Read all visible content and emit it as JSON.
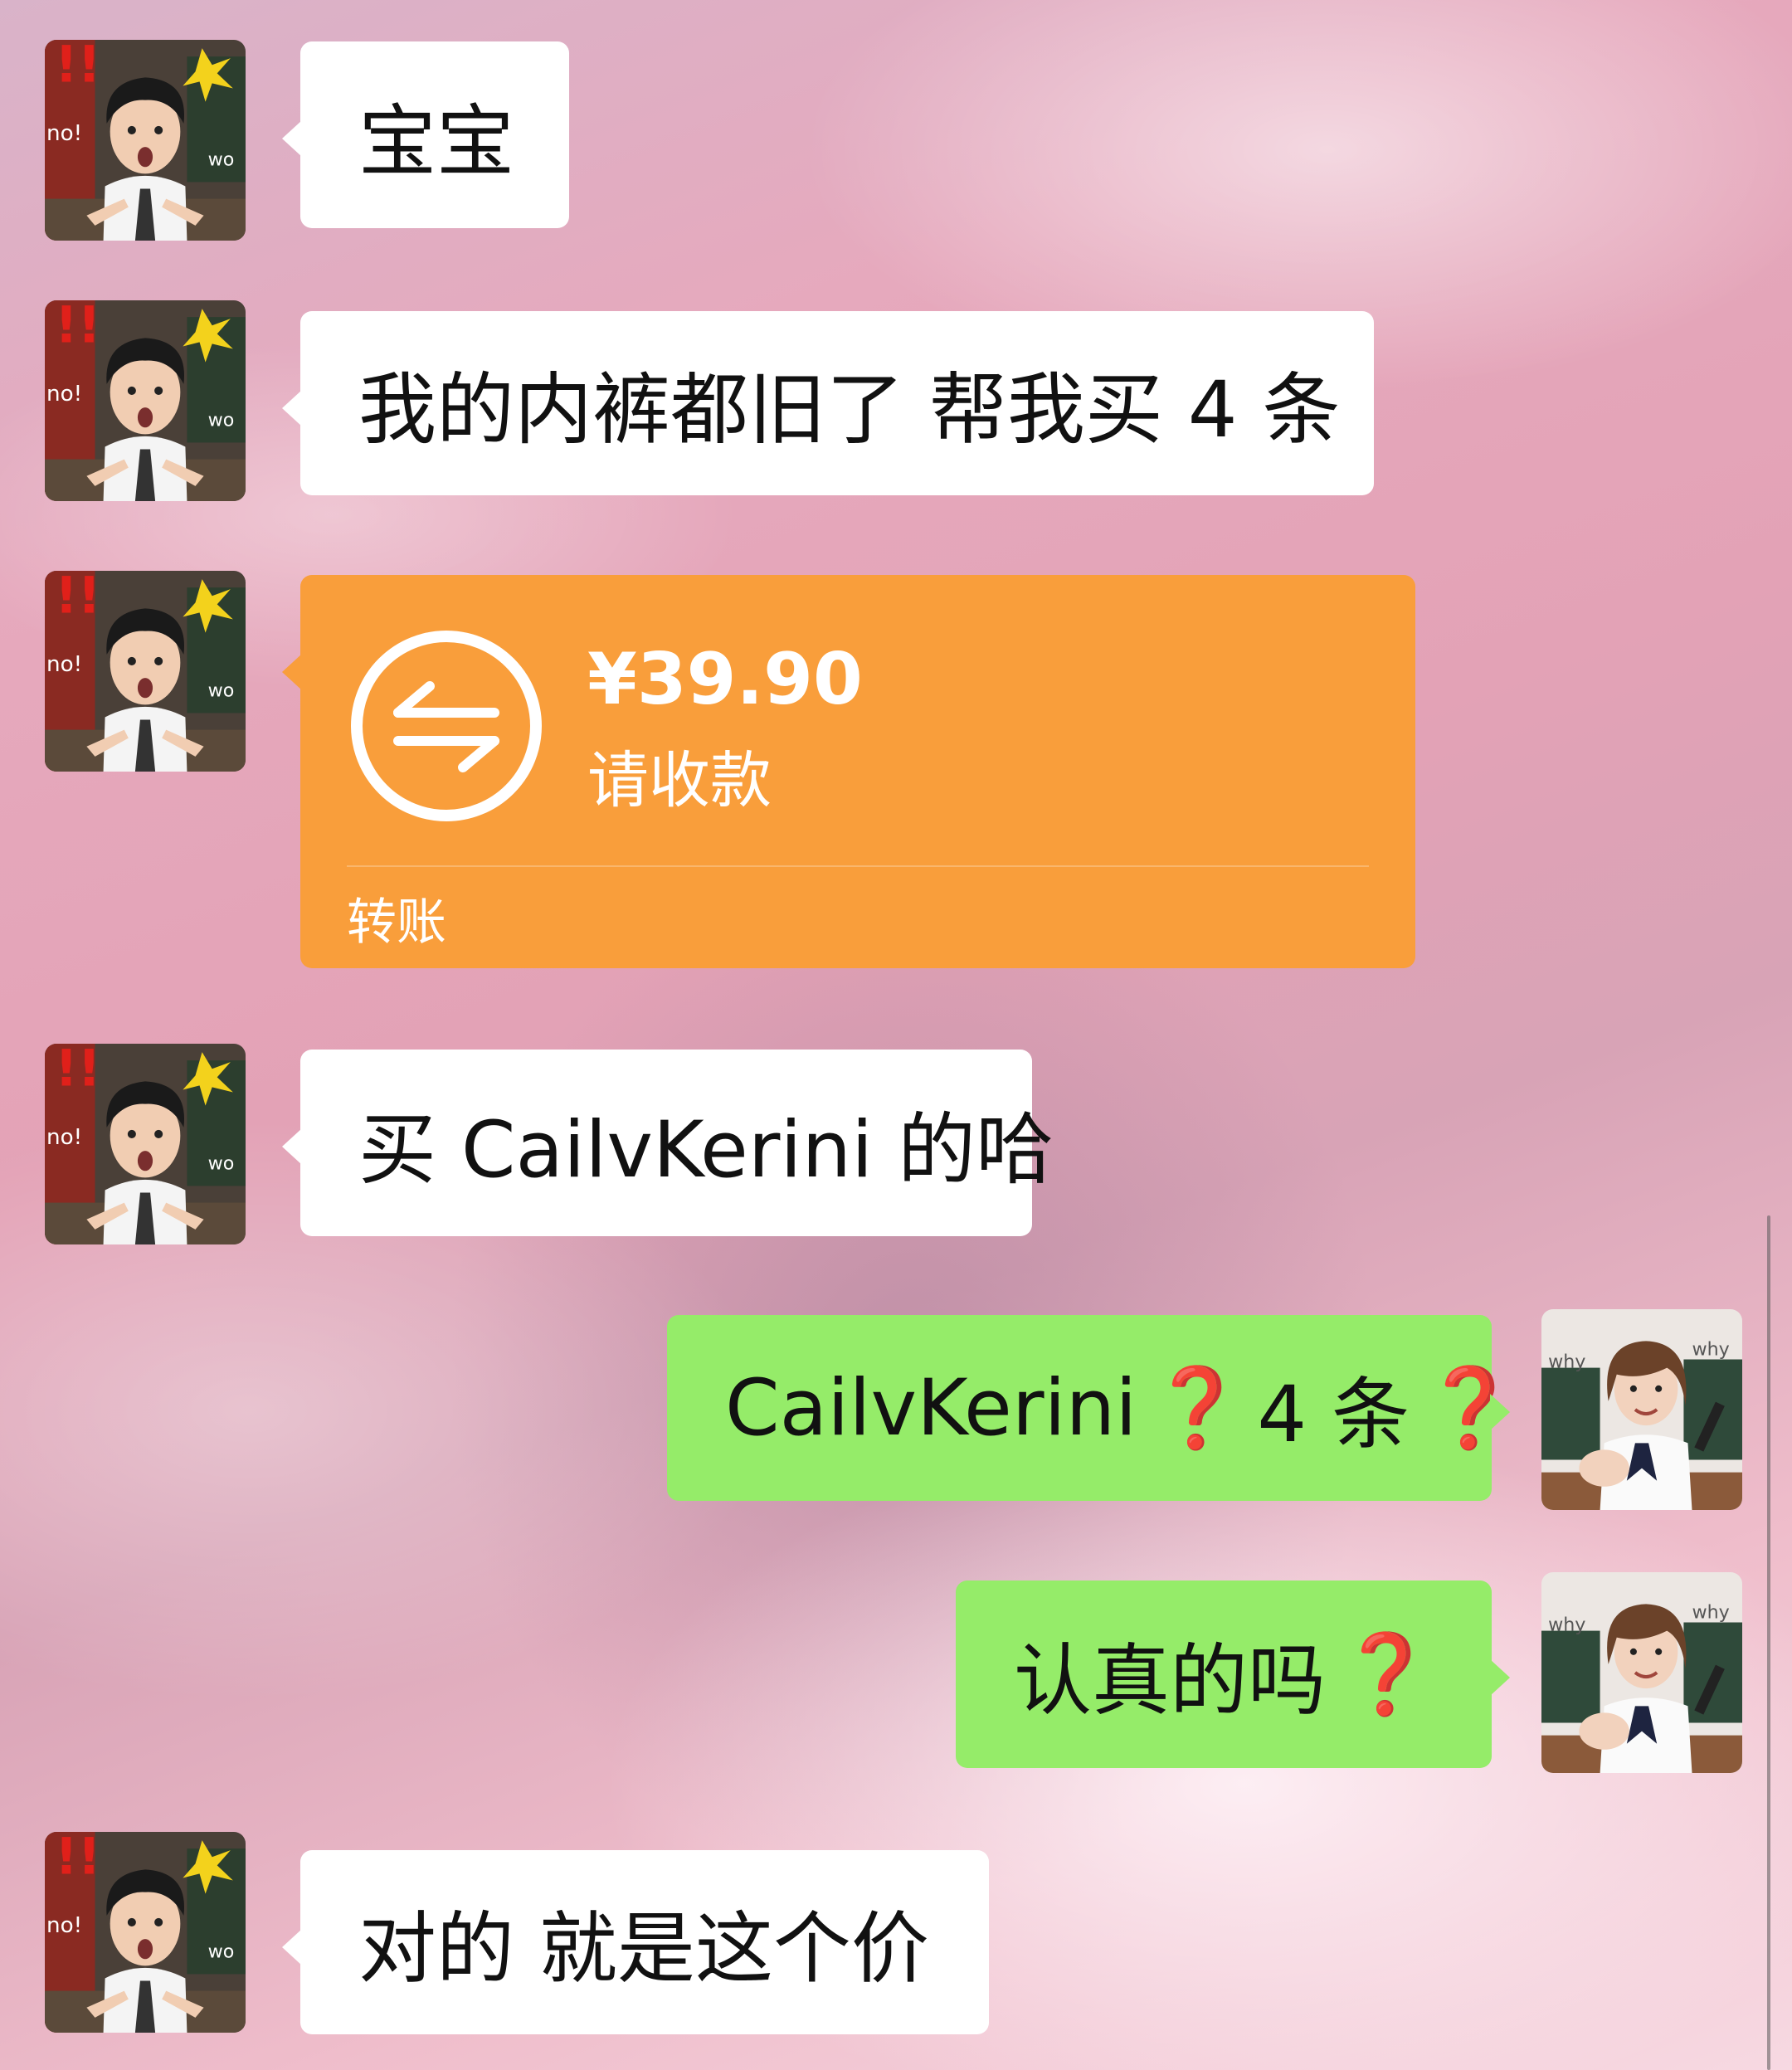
{
  "colors": {
    "incoming_bubble": "#ffffff",
    "outgoing_bubble": "#95ec69",
    "transfer_card": "#f99e3b",
    "question_mark": "#d9191b"
  },
  "avatars": {
    "contact": "contact-avatar-boy-shocked",
    "self": "self-avatar-girl-pointing"
  },
  "messages": [
    {
      "text": "宝宝"
    },
    {
      "text": "我的内裤都旧了 帮我买 4 条"
    },
    {
      "text": "买 CailvKerini 的哈"
    },
    {
      "text_a": "CailvKerini",
      "q1": "❓",
      "text_b": "4 条",
      "q2": "❓"
    },
    {
      "text": "认真的吗",
      "q": "❓"
    },
    {
      "text": "对的 就是这个价"
    }
  ],
  "transfer": {
    "amount": "¥39.90",
    "status": "请收款",
    "label": "转账",
    "icon": "transfer-arrows-icon"
  }
}
